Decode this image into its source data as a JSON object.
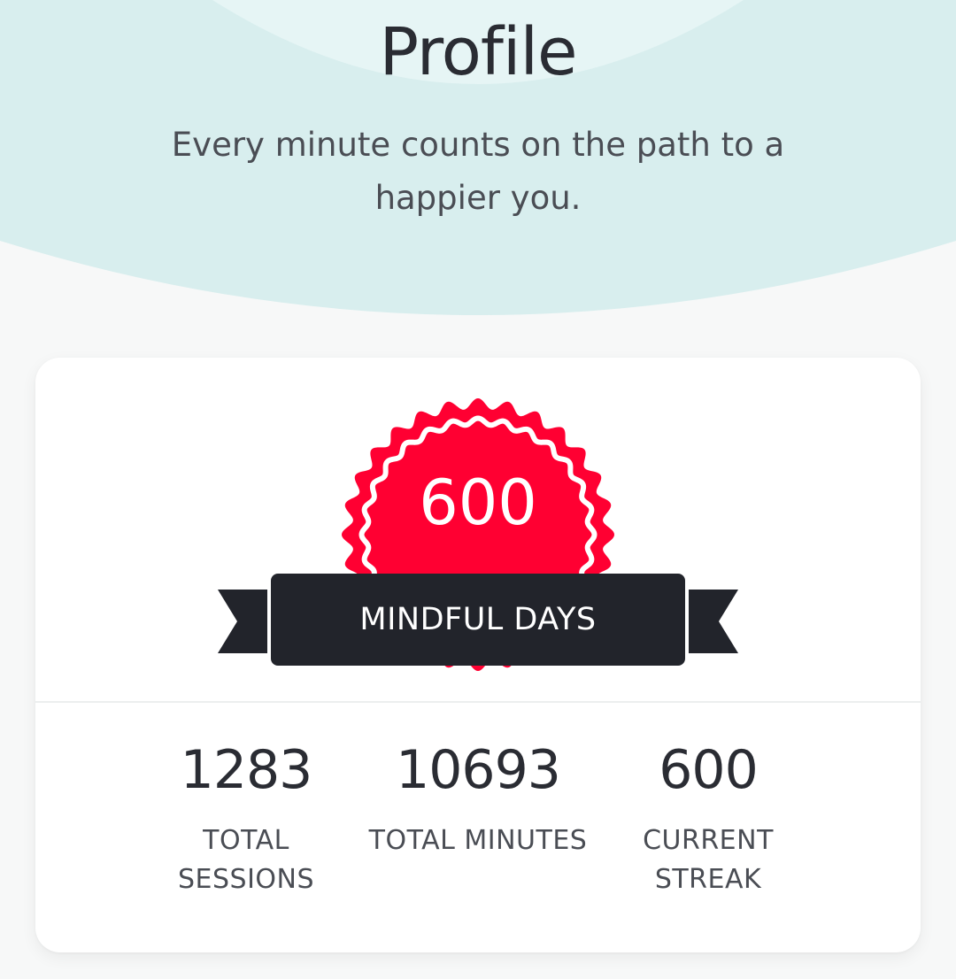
{
  "header": {
    "title": "Profile",
    "subtitle": "Every minute counts on the path to a happier you."
  },
  "badge": {
    "count": "600",
    "label": "MINDFUL DAYS"
  },
  "stats": [
    {
      "value": "1283",
      "label": "TOTAL SESSIONS"
    },
    {
      "value": "10693",
      "label": "TOTAL MINUTES"
    },
    {
      "value": "600",
      "label": "CURRENT STREAK"
    }
  ],
  "colors": {
    "header_bg": "#d8eeee",
    "header_glow": "#e6f5f5",
    "badge_red": "#ff0032",
    "ribbon_dark": "#22242b",
    "card_bg": "#ffffff",
    "page_bg": "#f7f8f8"
  }
}
